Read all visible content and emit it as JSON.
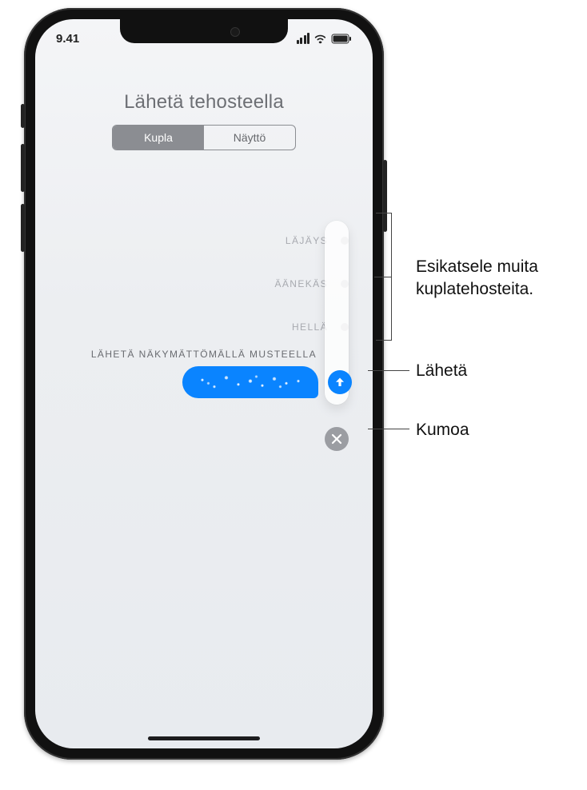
{
  "status": {
    "time": "9.41"
  },
  "title": "Lähetä tehosteella",
  "tabs": {
    "bubble": "Kupla",
    "screen": "Näyttö"
  },
  "effects": {
    "slam": "LÄJÄYS",
    "loud": "ÄÄNEKÄS",
    "gentle": "HELLÄ",
    "invisible": "LÄHETÄ NÄKYMÄTTÖMÄLLÄ MUSTEELLA"
  },
  "callouts": {
    "preview": "Esikatsele muita kuplatehosteita.",
    "send": "Lähetä",
    "cancel": "Kumoa"
  }
}
